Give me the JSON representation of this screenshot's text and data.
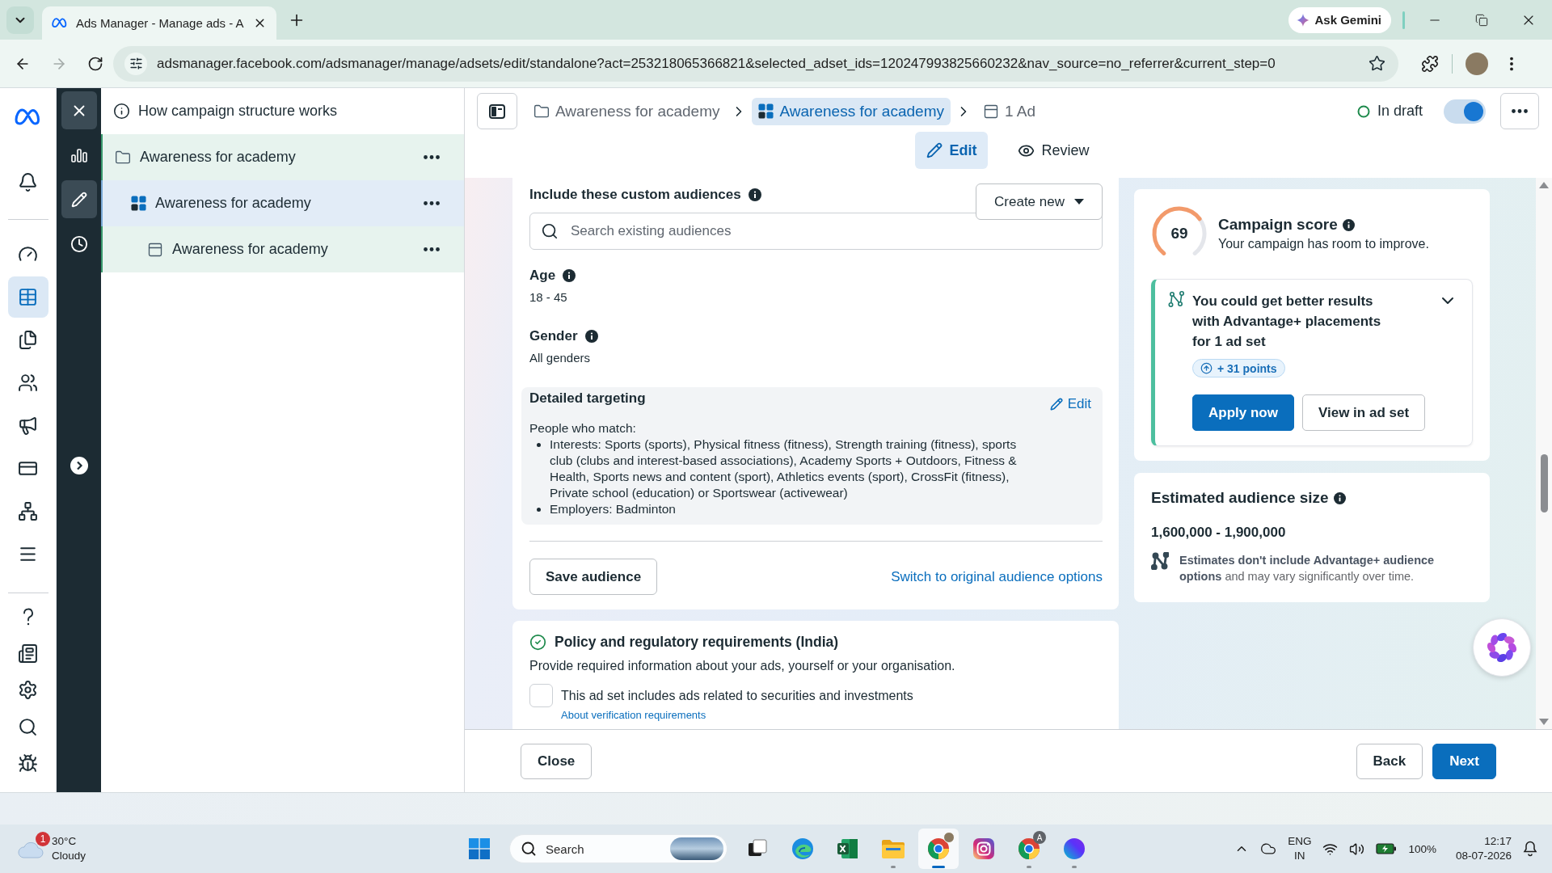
{
  "browser": {
    "tabs": [
      {
        "title": "Ads Manager - Manage ads - A",
        "selected": true
      }
    ],
    "gemini_button": "Ask Gemini",
    "nav_buttons": [
      {
        "kind": "back",
        "disabled": false
      },
      {
        "kind": "forward",
        "disabled": true
      },
      {
        "kind": "reload",
        "disabled": false
      }
    ],
    "url": "adsmanager.facebook.com/adsmanager/manage/adsets/edit/standalone?act=253218065366821&selected_adset_ids=120247993825660232&nav_source=no_referrer&current_step=0"
  },
  "nav_rail": {
    "top": [
      {
        "kind": "notifications",
        "selected": false
      }
    ],
    "main": [
      {
        "kind": "overview",
        "selected": false
      },
      {
        "kind": "manager",
        "selected": true
      },
      {
        "kind": "pages",
        "selected": false
      },
      {
        "kind": "audiences",
        "selected": false
      },
      {
        "kind": "campaigns",
        "selected": false
      },
      {
        "kind": "billing",
        "selected": false
      },
      {
        "kind": "events",
        "selected": false
      },
      {
        "kind": "all_tools",
        "selected": false
      }
    ],
    "bottom": [
      {
        "kind": "help",
        "selected": false
      },
      {
        "kind": "news",
        "selected": false
      },
      {
        "kind": "settings",
        "selected": false
      },
      {
        "kind": "search",
        "selected": false
      },
      {
        "kind": "debug",
        "selected": false
      }
    ]
  },
  "tool_rail": [
    {
      "kind": "performance",
      "selected": false
    },
    {
      "kind": "edit",
      "selected": true
    },
    {
      "kind": "history",
      "selected": false
    }
  ],
  "tree_panel": {
    "help_link": "How campaign structure works",
    "items": [
      {
        "kind": "campaign",
        "label": "Awareness for academy",
        "selected": false,
        "children": [
          {
            "kind": "adset",
            "label": "Awareness for academy",
            "selected": true,
            "children": [
              {
                "kind": "ad",
                "label": "Awareness for academy",
                "selected": false
              }
            ]
          }
        ]
      }
    ]
  },
  "header": {
    "breadcrumbs": [
      {
        "kind": "campaign",
        "label": "Awareness for academy",
        "selected": false
      },
      {
        "kind": "adset",
        "label": "Awareness for academy",
        "selected": true
      },
      {
        "kind": "ad",
        "label": "1 Ad",
        "selected": false
      }
    ],
    "status": "In draft",
    "toggle_on": true,
    "tabs": [
      {
        "kind": "edit",
        "label": "Edit",
        "selected": true
      },
      {
        "kind": "review",
        "label": "Review",
        "selected": false
      }
    ]
  },
  "audience": {
    "custom_audiences": {
      "label": "Include these custom audiences",
      "placeholder": "Search existing audiences",
      "create_button": "Create new"
    },
    "age": {
      "label": "Age",
      "value": "18 - 45"
    },
    "gender": {
      "label": "Gender",
      "value": "All genders"
    },
    "detailed_targeting": {
      "title": "Detailed targeting",
      "edit_link": "Edit",
      "intro": "People who match:",
      "items": [
        "Interests: Sports (sports), Physical fitness (fitness), Strength training (fitness), sports club (clubs and interest-based associations), Academy Sports + Outdoors, Fitness & Health, Sports news and content (sport), Athletics events (sport), CrossFit (fitness), Private school (education) or Sportswear (activewear)",
        "Employers: Badminton"
      ]
    },
    "save_button": "Save audience",
    "switch_link": "Switch to original audience options"
  },
  "policy": {
    "title": "Policy and regulatory requirements (India)",
    "description": "Provide required information about your ads, yourself or your organisation.",
    "checkbox": {
      "label": "This ad set includes ads related to securities and investments",
      "checked": false
    },
    "link": "About verification requirements"
  },
  "campaign_score": {
    "score": "69",
    "title": "Campaign score",
    "subtitle": "Your campaign has room to improve.",
    "recommendation": {
      "text": "You could get better results with Advantage+ placements for 1 ad set",
      "points": "+ 31 points",
      "expanded": false,
      "buttons": [
        {
          "kind": "primary",
          "label": "Apply now"
        },
        {
          "kind": "secondary",
          "label": "View in ad set"
        }
      ]
    }
  },
  "audience_size": {
    "title": "Estimated audience size",
    "range": "1,600,000 - 1,900,000",
    "note": "**Estimates don't include Advantage+ audience options** and may vary significantly over time."
  },
  "footer": {
    "close_button": "Close",
    "back_button": "Back",
    "next_button": "Next"
  },
  "taskbar": {
    "weather": {
      "alert_count": "1",
      "temperature": "30°C",
      "condition": "Cloudy"
    },
    "search_placeholder": "Search",
    "apps": [
      {
        "kind": "task_view",
        "running": false,
        "active": false
      },
      {
        "kind": "edge",
        "running": false,
        "active": false
      },
      {
        "kind": "excel",
        "running": false,
        "active": false
      },
      {
        "kind": "explorer",
        "running": true,
        "active": false
      },
      {
        "kind": "chrome",
        "running": true,
        "active": true,
        "badge": {
          "kind": "photo"
        }
      },
      {
        "kind": "instagram",
        "running": false,
        "active": false
      },
      {
        "kind": "chrome",
        "running": true,
        "active": false,
        "badge": {
          "kind": "letter",
          "text": "A"
        }
      },
      {
        "kind": "canva",
        "running": true,
        "active": false
      }
    ],
    "tray": {
      "language": "ENG",
      "region": "IN",
      "battery": "100%",
      "time": "12:17",
      "date": "08-07-2026"
    }
  }
}
